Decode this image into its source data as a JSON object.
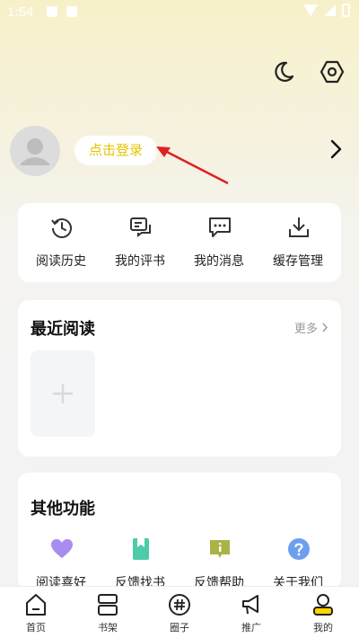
{
  "status_bar": {
    "time": "1:54"
  },
  "header": {
    "icons": [
      "moon-icon",
      "settings-hex-icon"
    ]
  },
  "profile": {
    "login_label": "点击登录",
    "avatar_icon": "user-placeholder-icon",
    "chevron_icon": "chevron-right-icon"
  },
  "quick_actions": [
    {
      "label": "阅读历史",
      "icon": "history-clock-icon"
    },
    {
      "label": "我的评书",
      "icon": "review-chat-icon"
    },
    {
      "label": "我的消息",
      "icon": "message-bubble-icon"
    },
    {
      "label": "缓存管理",
      "icon": "download-icon"
    }
  ],
  "recent_reading": {
    "title": "最近阅读",
    "more_label": "更多",
    "add_icon": "plus-icon"
  },
  "other_functions": {
    "title": "其他功能",
    "items": [
      {
        "label": "阅读喜好",
        "icon": "heart-icon",
        "color": "#a98cf0"
      },
      {
        "label": "反馈找书",
        "icon": "book-bookmark-icon",
        "color": "#4ecba8"
      },
      {
        "label": "反馈帮助",
        "icon": "info-box-icon",
        "color": "#aab347"
      },
      {
        "label": "关于我们",
        "icon": "question-circle-icon",
        "color": "#6c9ff0"
      }
    ]
  },
  "tab_bar": {
    "active_index": 4,
    "tabs": [
      {
        "label": "首页",
        "icon": "home-icon"
      },
      {
        "label": "书架",
        "icon": "bookshelf-icon"
      },
      {
        "label": "圈子",
        "icon": "hashtag-icon"
      },
      {
        "label": "推广",
        "icon": "megaphone-icon"
      },
      {
        "label": "我的",
        "icon": "profile-icon"
      }
    ]
  },
  "colors": {
    "accent_yellow": "#ffd400",
    "login_text": "#e6c400",
    "annotation_arrow": "#e02020"
  }
}
